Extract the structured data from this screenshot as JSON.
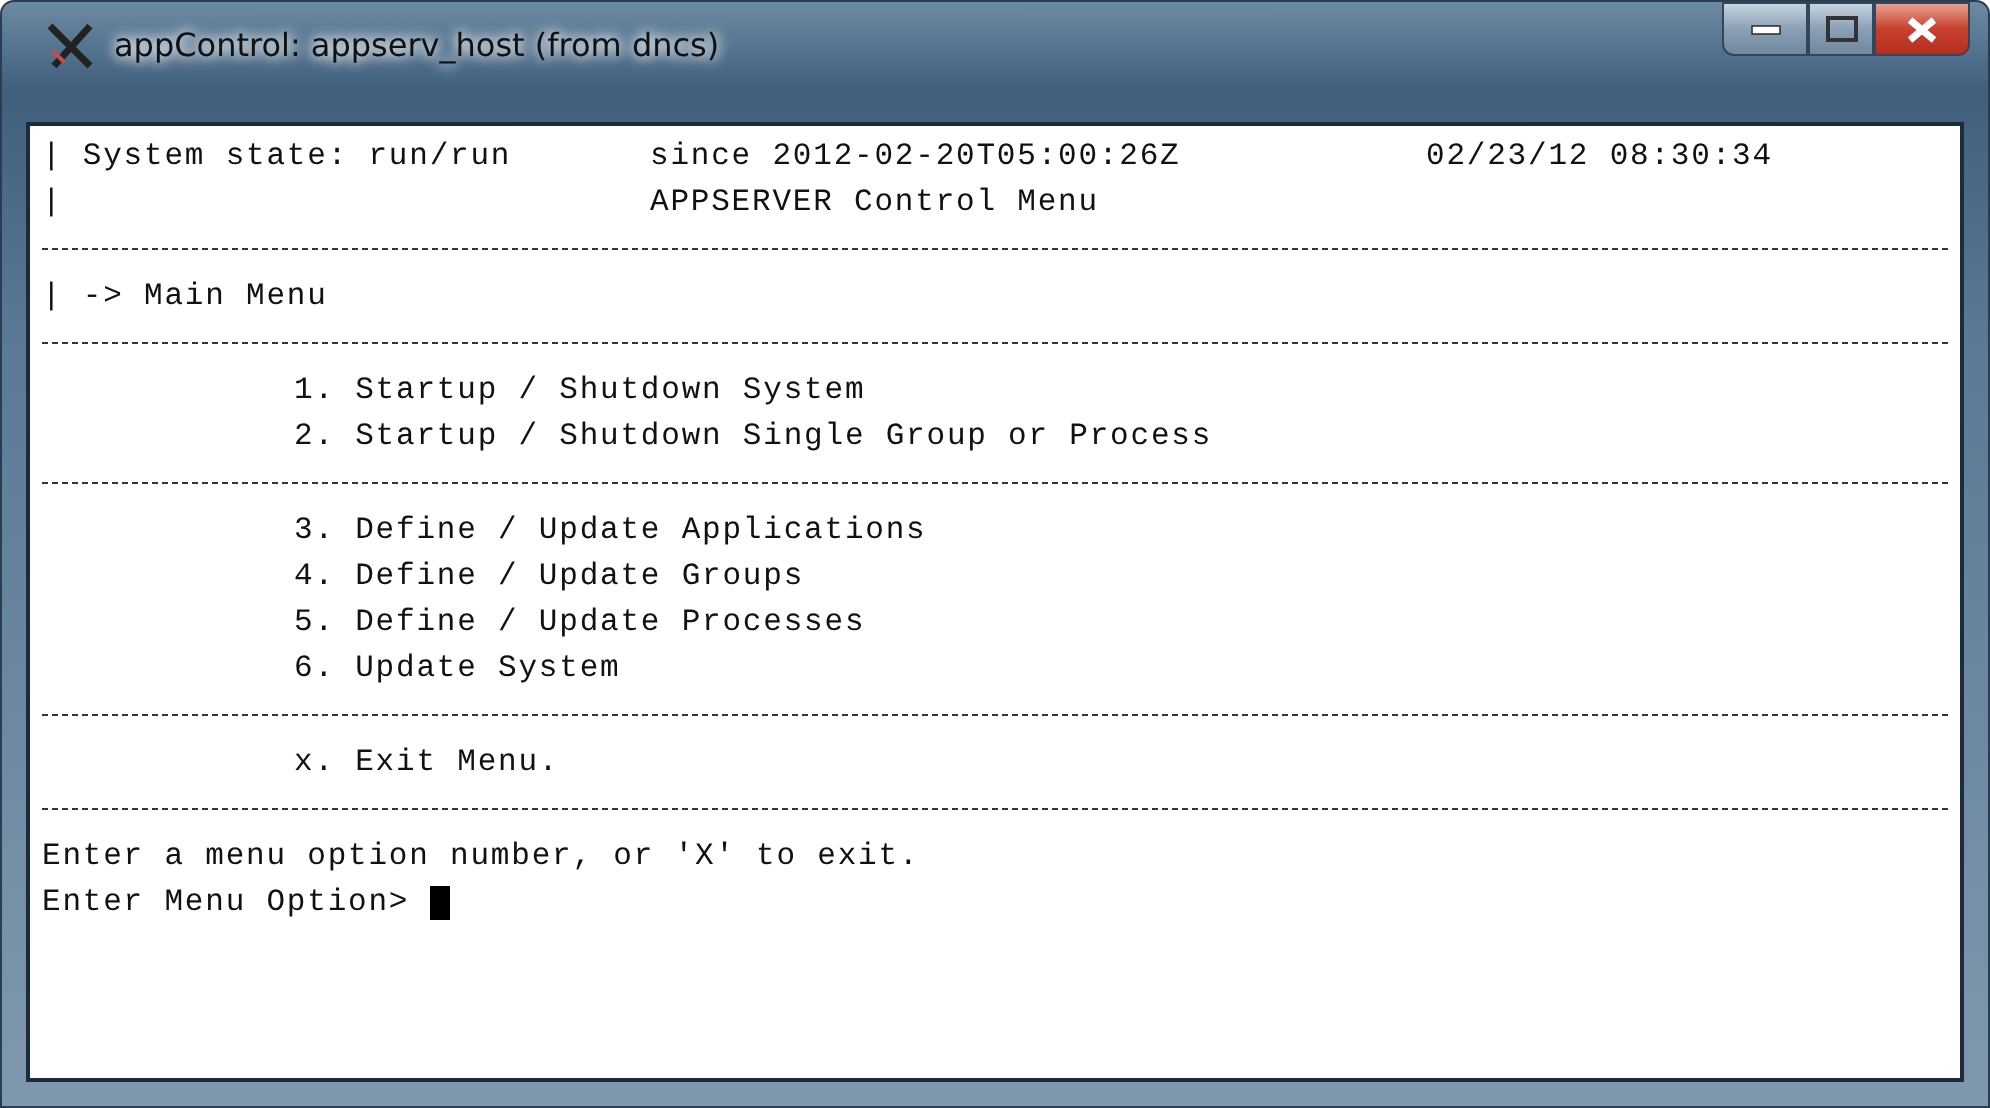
{
  "window": {
    "title": "appControl: appserv_host (from dncs)"
  },
  "header": {
    "state": "| System state: run/run",
    "since": "since 2012-02-20T05:00:26Z",
    "clock": "02/23/12 08:30:34",
    "bar": "|",
    "title": "APPSERVER Control Menu"
  },
  "breadcrumb": "| -> Main Menu",
  "menu_groups": [
    {
      "items": [
        "1. Startup / Shutdown System",
        "2. Startup / Shutdown Single Group or Process"
      ]
    },
    {
      "items": [
        "3. Define / Update Applications",
        "4. Define / Update Groups",
        "5. Define / Update Processes",
        "6. Update System"
      ]
    },
    {
      "items": [
        "x. Exit Menu."
      ]
    }
  ],
  "prompt": {
    "hint": "Enter a menu option number, or 'X' to exit.",
    "label": "Enter Menu Option>"
  }
}
